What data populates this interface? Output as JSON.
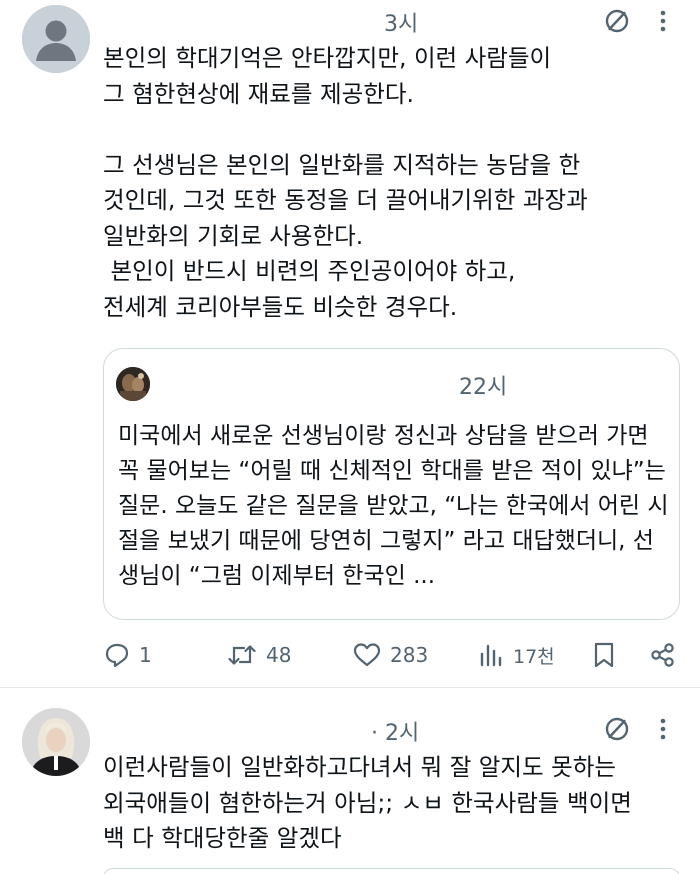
{
  "post1": {
    "time": "3시",
    "body": "본인의 학대기억은 안타깝지만, 이런 사람들이\n그 혐한현상에 재료를 제공한다.\n\n그 선생님은 본인의 일반화를 지적하는 농담을 한\n것인데, 그것 또한 동정을 더 끌어내기위한 과장과\n일반화의 기회로 사용한다.\n 본인이 반드시 비련의 주인공이어야 하고,\n전세계 코리아부들도 비슷한 경우다.",
    "quote": {
      "time": "22시",
      "text": "미국에서 새로운 선생님이랑 정신과 상담을 받으러 가면 꼭 물어보는 “어릴 때 신체적인 학대를 받은 적이 있냐”는 질문. 오늘도 같은 질문을 받았고, “나는 한국에서 어린 시절을 보냈기 때문에 당연히 그렇지” 라고 대답했더니, 선생님이 “그럼 이제부터 한국인 ..."
    },
    "actions": {
      "reply_count": "1",
      "repost_count": "48",
      "like_count": "283",
      "views_count": "17천"
    },
    "icons": [
      "no-entry-icon",
      "more-icon",
      "reply-icon",
      "repost-icon",
      "like-icon",
      "views-icon",
      "bookmark-icon",
      "share-icon"
    ]
  },
  "post2": {
    "time": "· 2시",
    "body": "이런사람들이 일반화하고다녀서 뭐 잘 알지도 못하는\n외국애들이 혐한하는거 아님;; ㅅㅂ 한국사람들 백이면\n백 다 학대당한줄 알겠다"
  },
  "colors": {
    "text": "#0f1419",
    "secondary": "#536471",
    "border": "#cfd9de"
  }
}
